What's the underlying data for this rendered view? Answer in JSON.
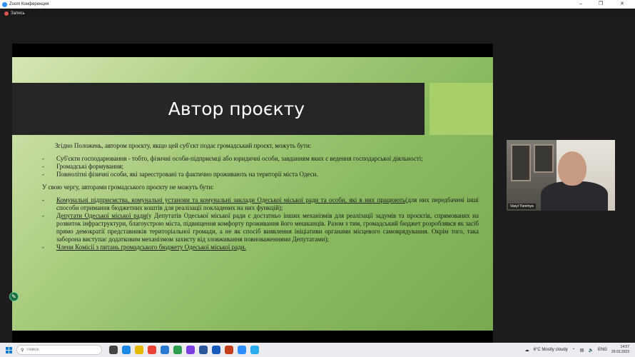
{
  "window": {
    "title": "Zoom Конференция",
    "minimize": "–",
    "maximize": "❐",
    "close": "✕"
  },
  "recording": {
    "label": "Запись"
  },
  "slide": {
    "title": "Автор проєкту",
    "intro": "Згідно Положень, автором проєкту, якщо цей суб'єкт подає громадський проєкт, можуть бути:",
    "authors": [
      "Суб'єкти господарювання - тобто, фізичні особи-підприємці або юридичні особи, завданням яких є ведення господарської діяльності;",
      "Громадські формування;",
      "Повнолітні фізичні особи, які зареєстровані та фактично проживають на території міста Одеси."
    ],
    "restrict_intro": "У свою чергу, авторами громадського проєкту не можуть бути:",
    "restricted": [
      {
        "u": "Комунальні підприємства, комунальні установи та комунальні заклади Одеської міської ради та особи, які в них працюють",
        "rest": "(для них передбачені інші способи отримання бюджетних коштів для реалізації покладених на них функцій);"
      },
      {
        "u": "Депутати Одеської міської ради",
        "rest": "(у Депутатів Одеської міської ради є достатньо інших механізмів для реалізації задумів та проєктів, спрямованих на розвиток інфраструктури, благоустрою міста, підвищення комфорту проживання його мешканців. Разом з тим, громадський бюджет розроблявся як засіб прямо демократії представників територіальної громади, а не як спосіб виявлення ініціативи органами місцевого самоврядування. Окрім того, така заборона виступає додатковим механізмом захисту від зловживання повноваженнями Депутатами);"
      },
      {
        "u": "Члени Комісії з питань громадського бюджету Одеської міської ради.",
        "rest": ""
      }
    ],
    "bullet": "-"
  },
  "participant": {
    "name": "Vasyl Yaremya"
  },
  "annotate": {
    "icon": "✎"
  },
  "taskbar": {
    "search_placeholder": "Поиск",
    "weather": "6°C  Mostly cloudy",
    "lang": "ENG",
    "time": "14:57",
    "date": "29.03.2023"
  }
}
